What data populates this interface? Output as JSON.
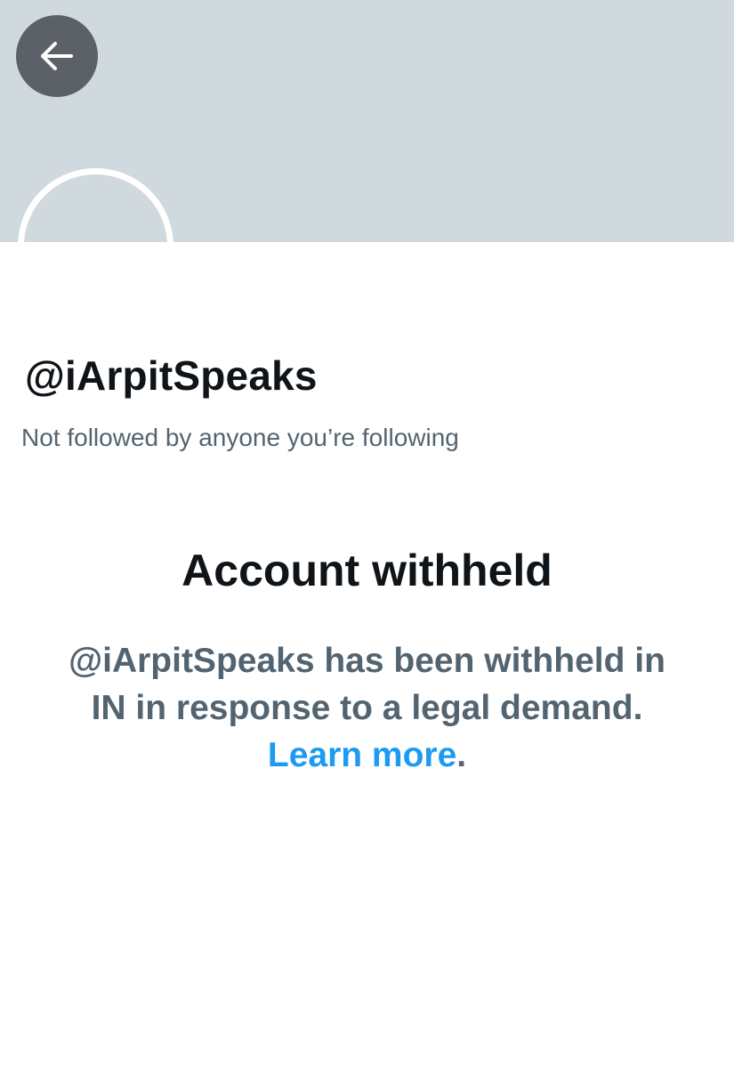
{
  "header": {
    "back_button_icon": "arrow-left-icon"
  },
  "profile": {
    "handle": "@iArpitSpeaks",
    "followed_note": "Not followed by anyone you’re following"
  },
  "withheld": {
    "title": "Account withheld",
    "message": "@iArpitSpeaks has been withheld in IN in response to a legal demand.",
    "learn_more": "Learn more",
    "trailing_period": "."
  },
  "colors": {
    "banner": "#cfd9de",
    "back_button": "#5b6167",
    "text_primary": "#0f1419",
    "text_secondary": "#536471",
    "link": "#1d9bf0"
  }
}
